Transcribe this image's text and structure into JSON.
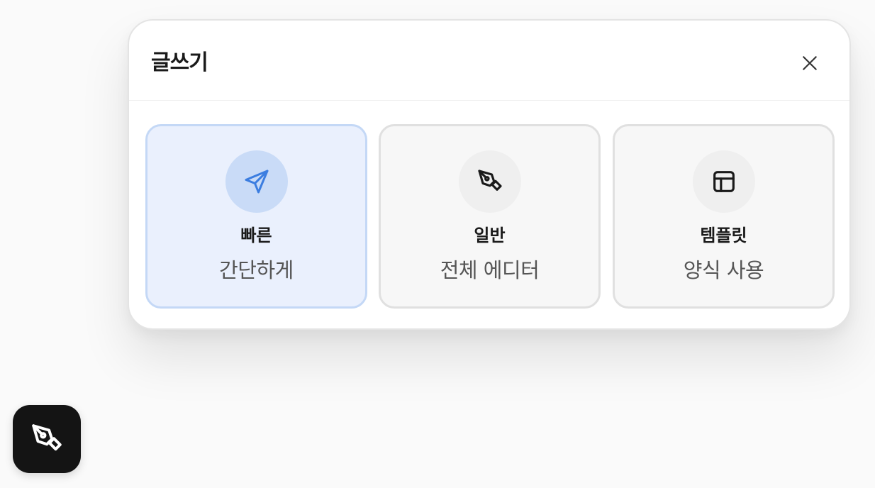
{
  "dialog": {
    "title": "글쓰기",
    "close_icon": "close-icon"
  },
  "options": [
    {
      "label": "빠른",
      "description": "간단하게",
      "icon": "send-icon",
      "selected": true
    },
    {
      "label": "일반",
      "description": "전체 에디터",
      "icon": "pen-icon",
      "selected": false
    },
    {
      "label": "템플릿",
      "description": "양식 사용",
      "icon": "layout-icon",
      "selected": false
    }
  ],
  "fab": {
    "icon": "pen-icon"
  },
  "colors": {
    "accent": "#3b7de0",
    "selected_bg": "#eaf0fd",
    "selected_border": "#c4d8f6",
    "fab_bg": "#141414"
  }
}
